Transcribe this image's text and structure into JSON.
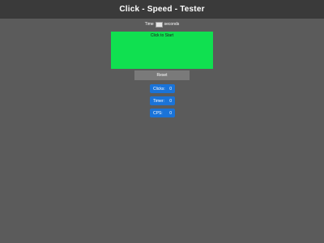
{
  "header": {
    "title": "Click - Speed - Tester"
  },
  "time_setting": {
    "prefix": "Time",
    "value": "",
    "suffix": "seconds"
  },
  "click_area": {
    "label": "Click to Start",
    "color": "#10e050"
  },
  "reset_button": {
    "label": "Reset"
  },
  "stats": {
    "clicks": {
      "label": "Clicks:",
      "value": "0"
    },
    "timer": {
      "label": "Timer:",
      "value": "0"
    },
    "cps": {
      "label": "CPS:",
      "value": "0"
    }
  },
  "colors": {
    "background": "#5b5b5b",
    "header_background": "#3a3a3a",
    "stat_background": "#1a73d8",
    "reset_background": "#7a7a7a"
  }
}
